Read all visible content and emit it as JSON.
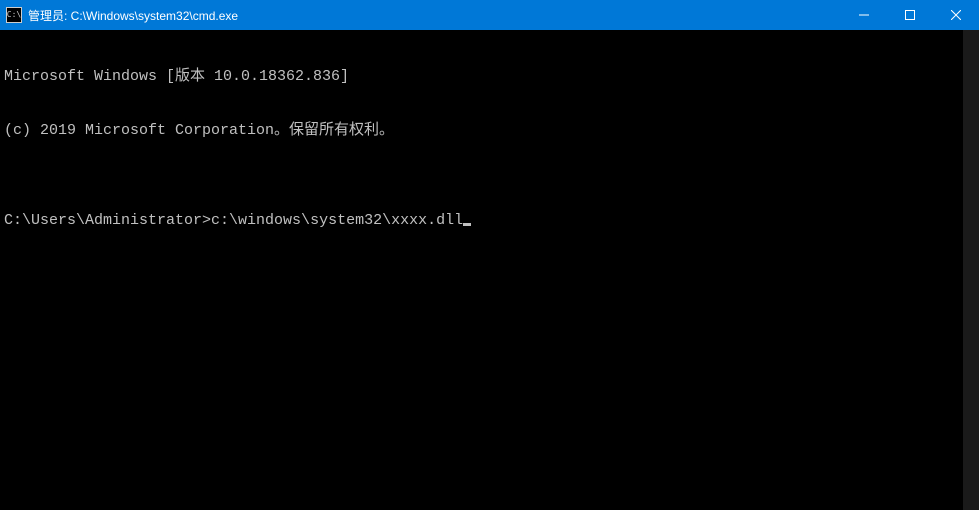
{
  "window": {
    "title": "管理员: C:\\Windows\\system32\\cmd.exe",
    "icon_text": "C:\\"
  },
  "terminal": {
    "lines": [
      "Microsoft Windows [版本 10.0.18362.836]",
      "(c) 2019 Microsoft Corporation。保留所有权利。",
      "",
      ""
    ],
    "prompt": "C:\\Users\\Administrator>",
    "input": "c:\\windows\\system32\\xxxx.dll"
  }
}
